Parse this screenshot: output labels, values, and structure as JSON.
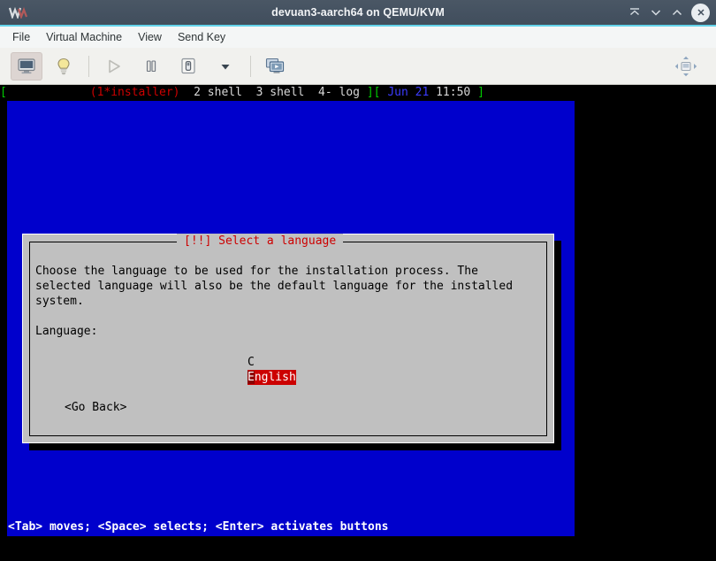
{
  "window": {
    "title": "devuan3-aarch64 on QEMU/KVM",
    "logo_icon": "virt-manager-logo-icon",
    "buttons": [
      {
        "name": "shade-button",
        "icon": "shade-icon",
        "label": ""
      },
      {
        "name": "minimize-button",
        "icon": "chevron-down-icon",
        "label": ""
      },
      {
        "name": "maximize-button",
        "icon": "chevron-up-icon",
        "label": ""
      },
      {
        "name": "close-button",
        "icon": "close-icon",
        "label": ""
      }
    ]
  },
  "menubar": {
    "items": [
      {
        "label": "File"
      },
      {
        "label": "Virtual Machine"
      },
      {
        "label": "View"
      },
      {
        "label": "Send Key"
      }
    ]
  },
  "toolbar": {
    "items": [
      {
        "name": "console-view-button",
        "icon": "monitor-icon",
        "state": "active"
      },
      {
        "name": "details-view-button",
        "icon": "lightbulb-icon",
        "state": "normal"
      },
      {
        "name": "run-button",
        "icon": "play-icon",
        "state": "disabled"
      },
      {
        "name": "pause-button",
        "icon": "pause-icon",
        "state": "normal"
      },
      {
        "name": "shutdown-button",
        "icon": "power-icon",
        "state": "normal"
      },
      {
        "name": "shutdown-menu-button",
        "icon": "chevron-down-icon",
        "state": "normal"
      },
      {
        "name": "snapshots-button",
        "icon": "snapshots-icon",
        "state": "normal"
      },
      {
        "name": "fullscreen-button",
        "icon": "fullscreen-icon",
        "state": "normal"
      }
    ]
  },
  "terminal": {
    "status_bar": {
      "left_bracket": "[",
      "gap": "            ",
      "active_window": "(1*installer)",
      "windows": "  2 shell  3 shell  4- log",
      "right_bracket_close": "]",
      "right_bracket_open": "[",
      "date": "Jun 21",
      "time": "11:50",
      "end_bracket": "]"
    },
    "help_line": "<Tab> moves; <Space> selects; <Enter> activates buttons"
  },
  "dialog": {
    "title": "[!!] Select a language",
    "body": "Choose the language to be used for the installation process. The\nselected language will also be the default language for the installed\nsystem.",
    "field_label": "Language:",
    "options": [
      {
        "label": "C",
        "selected": false
      },
      {
        "label": "English",
        "selected": true
      }
    ],
    "selected_cursor_char": "E",
    "selected_rest": "nglish",
    "back_button": "<Go Back>"
  },
  "colors": {
    "installer_blue": "#0000cc",
    "dialog_gray": "#c0c0c0",
    "alert_red": "#cc0000",
    "titlebar": "#455261",
    "accent_cyan": "#63d3ea"
  }
}
